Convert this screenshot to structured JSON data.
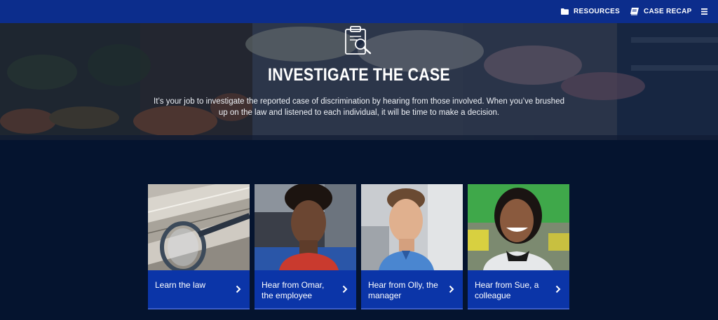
{
  "topbar": {
    "resources_label": "RESOURCES",
    "case_recap_label": "CASE RECAP",
    "resources_icon": "folder-icon",
    "case_recap_icon": "notebook-icon",
    "menu_icon": "hamburger-menu-icon"
  },
  "hero": {
    "icon": "clipboard-magnifier-icon",
    "title": "INVESTIGATE THE CASE",
    "description": "It’s your job to investigate the reported case of discrimination by hearing from those involved. When you’ve brushed up on the law and listened to each individual, it will be time to make a decision."
  },
  "cards": [
    {
      "label": "Learn the law",
      "image": "law-books-magnifying-glass-photo",
      "icon": "chevron-right-icon"
    },
    {
      "label": "Hear from Omar, the employee",
      "image": "omar-portrait-photo",
      "icon": "chevron-right-icon"
    },
    {
      "label": "Hear from Olly, the manager",
      "image": "olly-portrait-photo",
      "icon": "chevron-right-icon"
    },
    {
      "label": "Hear from Sue, a colleague",
      "image": "sue-portrait-photo",
      "icon": "chevron-right-icon"
    }
  ],
  "colors": {
    "topbar": "#0c2d8c",
    "page_background": "#05142f",
    "card_bar": "#0b35a8"
  }
}
